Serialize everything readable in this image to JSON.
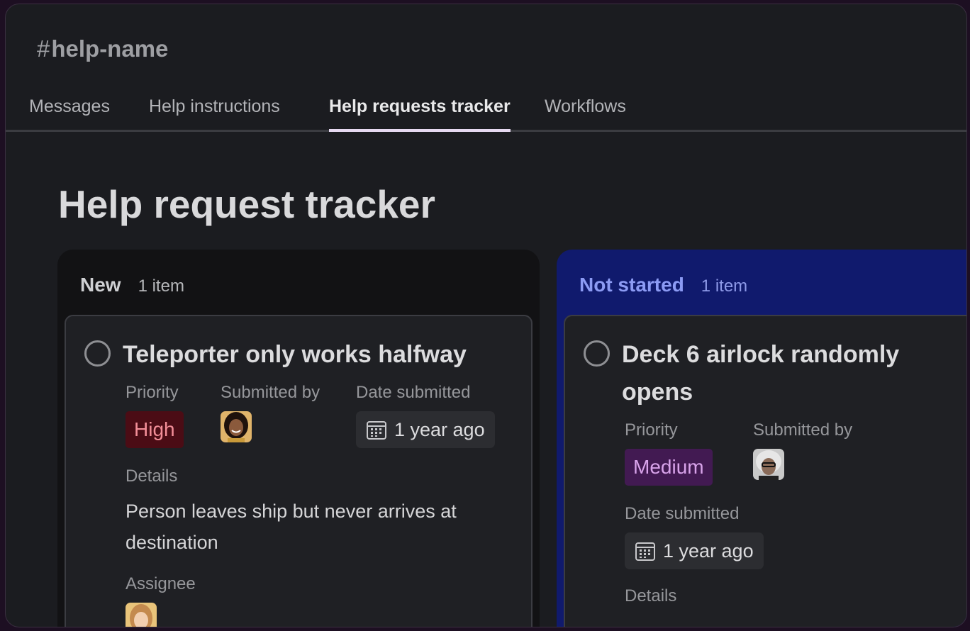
{
  "channel": {
    "hash": "#",
    "name": "help-name"
  },
  "tabs": [
    {
      "label": "Messages"
    },
    {
      "label": "Help instructions"
    },
    {
      "label": "Help requests tracker"
    },
    {
      "label": "Workflows"
    }
  ],
  "active_tab": "Help requests tracker",
  "page_title": "Help request tracker",
  "columns": [
    {
      "name": "New",
      "count": "1 item",
      "card": {
        "title": "Teleporter only works halfway",
        "priority_label": "Priority",
        "priority": "High",
        "submitted_by_label": "Submitted by",
        "date_label": "Date submitted",
        "date": "1 year ago",
        "details_label": "Details",
        "details": "Person leaves ship but never arrives at destination",
        "assignee_label": "Assignee"
      }
    },
    {
      "name": "Not started",
      "count": "1 item",
      "card": {
        "title": "Deck 6 airlock randomly opens",
        "priority_label": "Priority",
        "priority": "Medium",
        "submitted_by_label": "Submitted by",
        "date_label": "Date submitted",
        "date": "1 year ago",
        "details_label": "Details"
      }
    }
  ],
  "colors": {
    "background": "#1b1c20",
    "not_started_column": "#101a6d",
    "high_badge": "#4b0c15",
    "medium_badge": "#421a52",
    "active_tab_underline": "#e6d9f0"
  },
  "icons": [
    "calendar-icon",
    "checkbox-circle-icon",
    "avatar"
  ]
}
